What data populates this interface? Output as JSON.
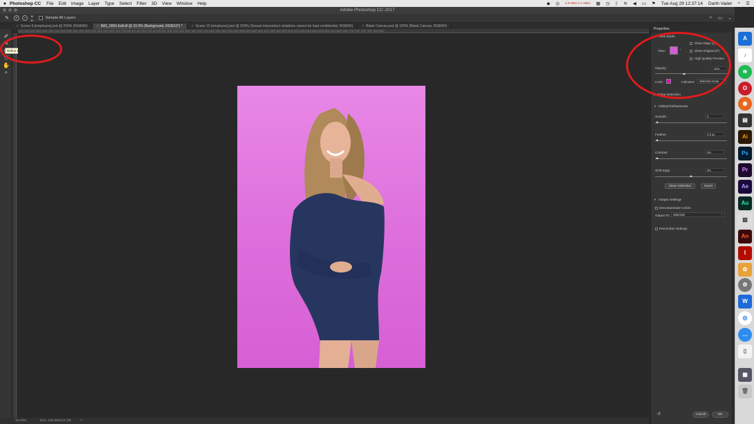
{
  "menubar": {
    "apple": "",
    "app_name": "Photoshop CC",
    "menus": [
      "File",
      "Edit",
      "Image",
      "Layer",
      "Type",
      "Select",
      "Filter",
      "3D",
      "View",
      "Window",
      "Help"
    ],
    "clock": "Tue Aug 29  12:37:14",
    "user": "Darth Vader",
    "battery_text": "3.8 MB/s\n0.1 MB/s"
  },
  "window": {
    "title": "Adobe Photoshop CC 2017"
  },
  "options_bar": {
    "brush_size": "30",
    "sample_all_layers": "Sample All Layers"
  },
  "tabs": [
    {
      "label": "Scene 9 [employee].psd @ 200% (RGB/8#)",
      "active": false
    },
    {
      "label": "IMG_0065-Edit.tif @ 33.3% (Background, RGB/16*) *",
      "active": true
    },
    {
      "label": "Scene 15 [employee].psd @ 203% (Sexual misconduct violations cannot be kept confidential, RGB/8#)",
      "active": false
    },
    {
      "label": "Blank Canvas.psd @ 100% (Blank Canvas, RGB/8#)",
      "active": false
    }
  ],
  "ruler_text": "4400  4200  4000  3800  3600  3400  3200  3000  2800  2600  2400  2200  2000  1800  1600  1400  1200  1000   800   600   400   200     0   200   400   600   800  1000  1200  1400  1600  1800  2000  2200  2400  2600  2800  3000  3200  3400  3600  3800  4000  4200  4400  4600  4800  5000  5200  5400  5600  5800  6000  6200  6400  6600  6800  7000  7200  7400  7600  7800  8000",
  "tooltip": "Refine Edge Brush Tool (R)",
  "status": {
    "zoom": "33.33%",
    "doc": "Doc: 128.8M/412.7M",
    "arrow": ">"
  },
  "properties": {
    "title": "Properties",
    "view_mode": "View Mode",
    "view_label": "View:",
    "show_edge": "Show Edge (J)",
    "show_original": "Show Original (P)",
    "high_quality": "High Quality Preview",
    "opacity_label": "Opacity:",
    "opacity_value": "40%",
    "opacity_level": 0.4,
    "color_label": "Color:",
    "color": "#ea00d9",
    "indicates_label": "Indicates:",
    "indicates_value": "Selected Areas",
    "edge_detection": "Edge Detection",
    "global_refinements": "Global Refinements",
    "smooth_label": "Smooth:",
    "smooth_value": "0",
    "feather_label": "Feather:",
    "feather_value": "0.0 px",
    "contrast_label": "Contrast:",
    "contrast_value": "0%",
    "shift_label": "Shift Edge:",
    "shift_value": "0%",
    "clear_selection": "Clear Selection",
    "invert": "Invert",
    "output_settings": "Output Settings",
    "decontaminate": "Decontaminate Colors",
    "output_to_label": "Output To:",
    "output_to_value": "Selection",
    "remember": "Remember Settings",
    "cancel": "Cancel",
    "ok": "OK"
  },
  "dock": {
    "ai": "Ai",
    "ps": "Ps",
    "pr": "Pr",
    "ae": "Ae",
    "au": "Au",
    "an": "An"
  }
}
